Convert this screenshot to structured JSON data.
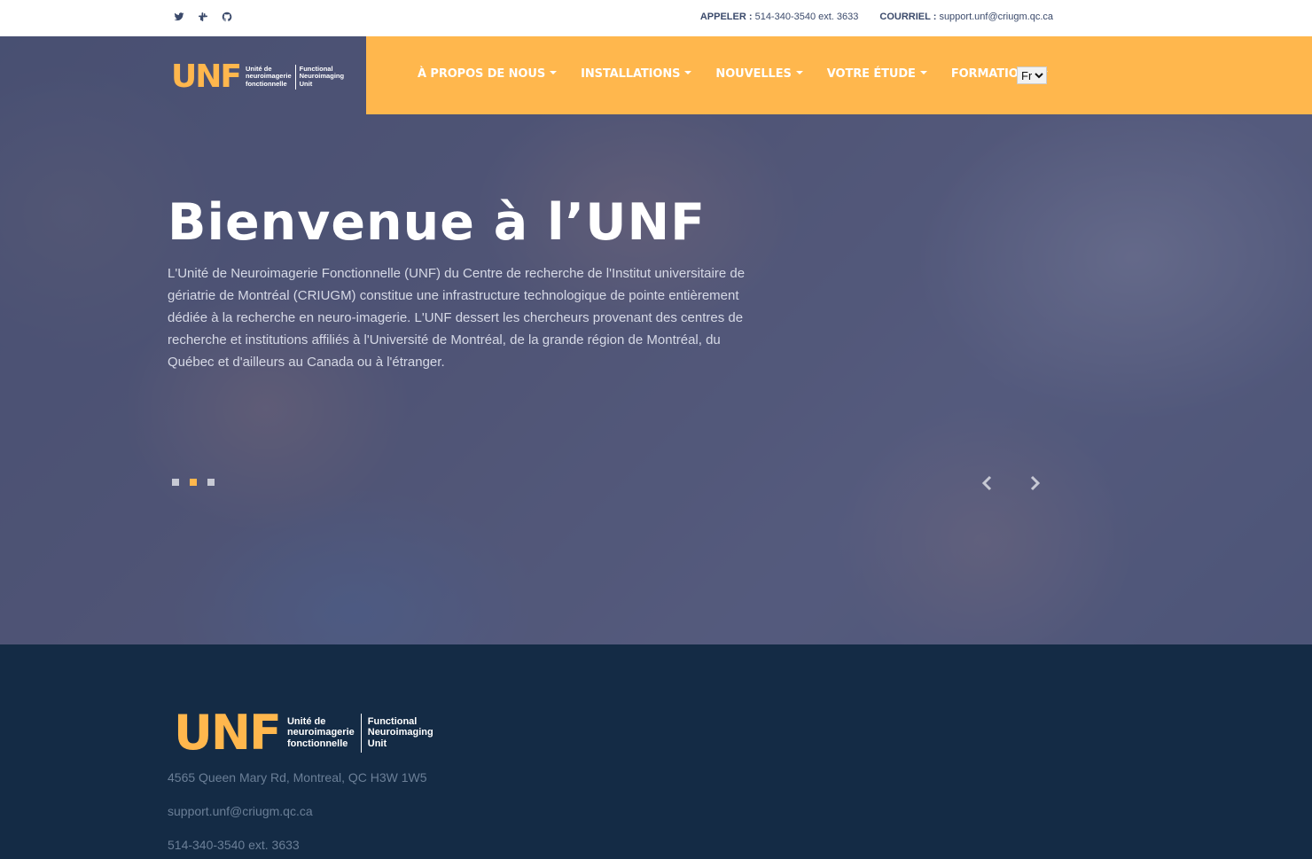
{
  "topbar": {
    "social": [
      "twitter-icon",
      "slack-icon",
      "github-icon"
    ],
    "call_label": "APPELER :",
    "call_value": "514-340-3540 ext. 3633",
    "email_label": "COURRIEL :",
    "email_value": "support.unf@criugm.qc.ca"
  },
  "logo": {
    "mark": "UNF",
    "fr_line1": "Unité de",
    "fr_line2": "neuroimagerie",
    "fr_line3": "fonctionnelle",
    "en_line1": "Functional",
    "en_line2": "Neuroimaging",
    "en_line3": "Unit"
  },
  "nav": {
    "items": [
      "À PROPOS DE NOUS",
      "INSTALLATIONS",
      "NOUVELLES",
      "VOTRE ÉTUDE",
      "FORMATIONS"
    ],
    "language": "Fr"
  },
  "hero": {
    "title": "Bienvenue à l’UNF",
    "text": "L'Unité de Neuroimagerie Fonctionnelle (UNF) du Centre de recherche de l'Institut universitaire de gériatrie de Montréal (CRIUGM) constitue une infrastructure technologique de pointe entièrement dédiée à la recherche en neuro-imagerie. L'UNF dessert les chercheurs provenant des centres de recherche et institutions affiliés à l'Université de Montréal, de la grande région de Montréal, du Québec et d'ailleurs au Canada ou à l'étranger.",
    "slides": 3,
    "active_slide": 2
  },
  "footer": {
    "address": "4565 Queen Mary Rd, Montreal, QC H3W 1W5",
    "email": "support.unf@criugm.qc.ca",
    "phone": "514-340-3540 ext. 3633"
  },
  "colors": {
    "accent": "#ffb74d",
    "footer_bg": "#142b45",
    "hero_overlay": "#343e70",
    "topbar_text": "#3b4a6b"
  }
}
